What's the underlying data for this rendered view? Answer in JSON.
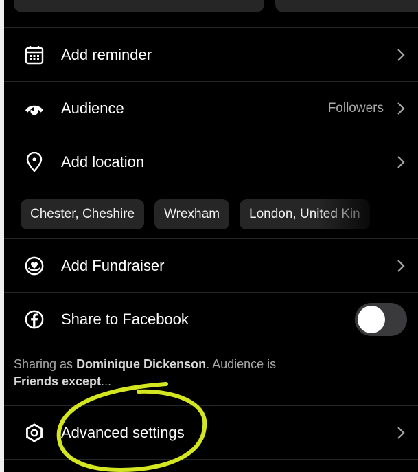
{
  "settings": {
    "reminder": {
      "label": "Add reminder",
      "icon": "calendar-icon"
    },
    "audience": {
      "label": "Audience",
      "value": "Followers",
      "icon": "audience-eye-icon"
    },
    "location": {
      "label": "Add location",
      "icon": "location-pin-icon"
    },
    "location_suggestions": [
      "Chester, Cheshire",
      "Wrexham",
      "London, United Kin"
    ],
    "fundraiser": {
      "label": "Add Fundraiser",
      "icon": "fundraiser-icon"
    },
    "facebook": {
      "label": "Share to Facebook",
      "icon": "facebook-icon",
      "toggle_on": false
    },
    "sharing_note": {
      "prefix": "Sharing as ",
      "name": "Dominique Dickenson",
      "middle": ". Audience is ",
      "audience": "Friends except",
      "suffix": "..."
    },
    "advanced": {
      "label": "Advanced settings",
      "icon": "gear-icon"
    }
  },
  "colors": {
    "background": "#000000",
    "page_border": "#efeeec",
    "chip": "#262626",
    "secondary_text": "#a8a8a8",
    "highlight_annotation": "#d4e61f"
  }
}
